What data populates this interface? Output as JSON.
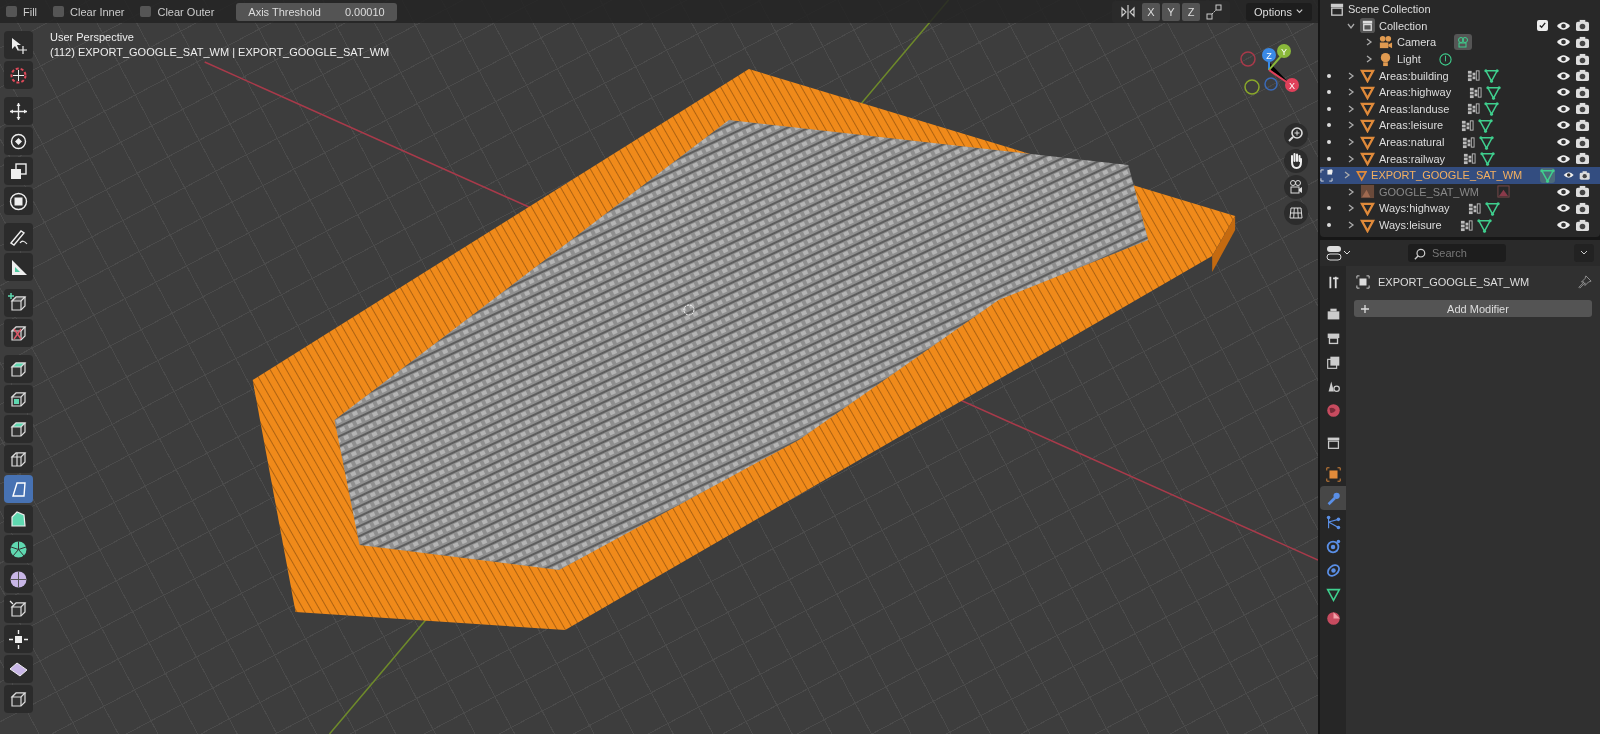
{
  "header": {
    "options": [
      {
        "label": "Fill",
        "checked": false
      },
      {
        "label": "Clear Inner",
        "checked": false
      },
      {
        "label": "Clear Outer",
        "checked": false
      }
    ],
    "threshold": {
      "label": "Axis Threshold",
      "value": "0.00010"
    },
    "axes": [
      {
        "label": "X",
        "selected": false
      },
      {
        "label": "Y",
        "selected": false
      },
      {
        "label": "Z",
        "selected": false
      }
    ],
    "menu": "Options"
  },
  "toolbar": {
    "tools": [
      {
        "selected": false
      },
      {
        "selected": false
      },
      {
        "selected": false
      },
      {
        "selected": false
      },
      {
        "selected": false
      },
      {
        "selected": false
      },
      {
        "selected": false
      },
      {
        "selected": false
      },
      {
        "selected": false
      },
      {
        "selected": false
      },
      {
        "selected": false
      },
      {
        "selected": false
      },
      {
        "selected": false
      },
      {
        "selected": false
      },
      {
        "selected": true
      },
      {
        "selected": false
      },
      {
        "selected": false
      },
      {
        "selected": false
      },
      {
        "selected": false
      },
      {
        "selected": false
      },
      {
        "selected": false
      },
      {
        "selected": false
      }
    ]
  },
  "viewport": {
    "view_name": "User Perspective",
    "object_info": "(112) EXPORT_GOOGLE_SAT_WM | EXPORT_GOOGLE_SAT_WM",
    "gizmo": [
      "Z",
      "Y",
      "X"
    ]
  },
  "outliner": {
    "title": "Scene Collection",
    "items": [
      {
        "label": "Collection",
        "kind": "collection",
        "selected": false,
        "disabled": false,
        "expanded": true,
        "checked": true,
        "children": [
          {
            "label": "Camera",
            "kind": "camera",
            "selected": false,
            "disabled": false,
            "expanded": false
          },
          {
            "label": "Light",
            "kind": "light",
            "selected": false,
            "disabled": false,
            "expanded": false
          }
        ]
      },
      {
        "label": "Areas:building",
        "kind": "mesh",
        "selected": false,
        "disabled": false,
        "expanded": false
      },
      {
        "label": "Areas:highway",
        "kind": "mesh",
        "selected": false,
        "disabled": false,
        "expanded": false
      },
      {
        "label": "Areas:landuse",
        "kind": "mesh",
        "selected": false,
        "disabled": false,
        "expanded": false
      },
      {
        "label": "Areas:leisure",
        "kind": "mesh",
        "selected": false,
        "disabled": false,
        "expanded": false
      },
      {
        "label": "Areas:natural",
        "kind": "mesh",
        "selected": false,
        "disabled": false,
        "expanded": false
      },
      {
        "label": "Areas:railway",
        "kind": "mesh",
        "selected": false,
        "disabled": false,
        "expanded": false
      },
      {
        "label": "EXPORT_GOOGLE_SAT_WM",
        "kind": "mesh",
        "selected": true,
        "disabled": false,
        "expanded": false
      },
      {
        "label": "GOOGLE_SAT_WM",
        "kind": "image",
        "selected": false,
        "disabled": true,
        "expanded": false
      },
      {
        "label": "Ways:highway",
        "kind": "mesh",
        "selected": false,
        "disabled": false,
        "expanded": false
      },
      {
        "label": "Ways:leisure",
        "kind": "mesh",
        "selected": false,
        "disabled": false,
        "expanded": false
      }
    ]
  },
  "properties": {
    "search": {
      "placeholder": "Search"
    },
    "tabs": [
      {
        "selected": false
      },
      {
        "selected": false
      },
      {
        "selected": false
      },
      {
        "selected": false
      },
      {
        "selected": false
      },
      {
        "selected": false
      },
      {
        "selected": false
      },
      {
        "selected": false
      },
      {
        "selected": true
      },
      {
        "selected": false
      },
      {
        "selected": false
      },
      {
        "selected": false
      },
      {
        "selected": false
      },
      {
        "selected": false
      }
    ],
    "object_name": "EXPORT_GOOGLE_SAT_WM",
    "add_button": "Add Modifier"
  }
}
